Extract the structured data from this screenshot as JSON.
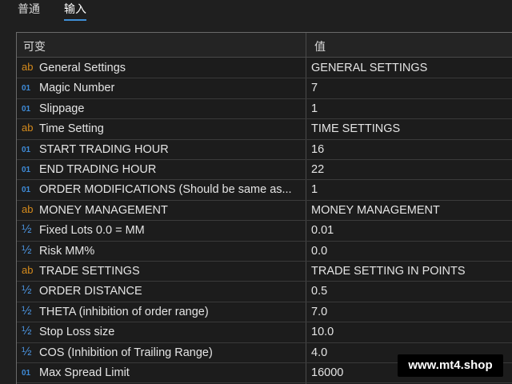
{
  "tabs": [
    {
      "label": "普通"
    },
    {
      "label": "输入"
    }
  ],
  "table": {
    "headers": {
      "variable": "可变",
      "value": "值"
    },
    "rows": [
      {
        "icon": "ab",
        "type": "string-icon",
        "name": "General Settings",
        "value": "GENERAL SETTINGS"
      },
      {
        "icon": "01",
        "type": "integer-icon",
        "name": "Magic Number",
        "value": "7"
      },
      {
        "icon": "01",
        "type": "integer-icon",
        "name": "Slippage",
        "value": "1"
      },
      {
        "icon": "ab",
        "type": "string-icon",
        "name": "Time Setting",
        "value": "TIME SETTINGS"
      },
      {
        "icon": "01",
        "type": "integer-icon",
        "name": "START TRADING HOUR",
        "value": "16"
      },
      {
        "icon": "01",
        "type": "integer-icon",
        "name": "END TRADING HOUR",
        "value": "22"
      },
      {
        "icon": "01",
        "type": "integer-icon",
        "name": "ORDER MODIFICATIONS (Should be same as...",
        "value": "1"
      },
      {
        "icon": "ab",
        "type": "string-icon",
        "name": "MONEY MANAGEMENT",
        "value": "MONEY MANAGEMENT"
      },
      {
        "icon": "½",
        "type": "double-icon",
        "name": "Fixed Lots 0.0 = MM",
        "value": "0.01"
      },
      {
        "icon": "½",
        "type": "double-icon",
        "name": "Risk MM%",
        "value": "0.0"
      },
      {
        "icon": "ab",
        "type": "string-icon",
        "name": "TRADE SETTINGS",
        "value": "TRADE SETTING IN POINTS"
      },
      {
        "icon": "½",
        "type": "double-icon",
        "name": "ORDER DISTANCE",
        "value": "0.5"
      },
      {
        "icon": "½",
        "type": "double-icon",
        "name": "THETA (inhibition of order range)",
        "value": "7.0"
      },
      {
        "icon": "½",
        "type": "double-icon",
        "name": "Stop Loss size",
        "value": "10.0"
      },
      {
        "icon": "½",
        "type": "double-icon",
        "name": "COS (Inhibition of Trailing Range)",
        "value": "4.0"
      },
      {
        "icon": "01",
        "type": "integer-icon",
        "name": "Max Spread Limit",
        "value": "16000"
      }
    ]
  },
  "watermark": "www.mt4.shop",
  "colors": {
    "accent": "#3f8fd6",
    "string_icon": "#d48a1c",
    "number_icon": "#3e8bd8"
  }
}
